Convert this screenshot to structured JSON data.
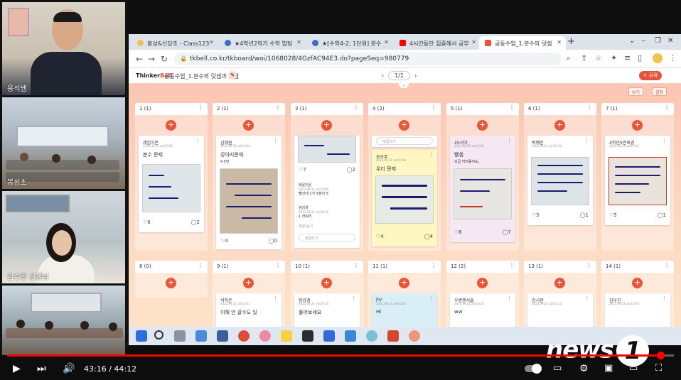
{
  "webcams": [
    {
      "label": "용석쌤"
    },
    {
      "label": "봉성초"
    },
    {
      "label": "김수연 선생님"
    },
    {
      "label": ""
    }
  ],
  "browser": {
    "tabs": [
      {
        "label": "봉성&신당초 - Class123"
      },
      {
        "label": "★4학년2학기 수학 밥팅"
      },
      {
        "label": "★[수학4-2, 1단원] 분수"
      },
      {
        "label": "4시간동안 집중해서 공부"
      },
      {
        "label": "공동수업_1.분수의 덧셈"
      }
    ],
    "url": "tkbell.co.kr/tkboard/woi/1068028/4GzfAC94E3.do?pageSeq=980779"
  },
  "app": {
    "logo_a": "Thinker",
    "logo_b": "Bell",
    "board_title": "공동수업_1.분수의 덧셈과 뺄셈",
    "pager": "1/1",
    "share_label": "+ 공유",
    "btn_a": "보기",
    "btn_b": "설정"
  },
  "columns_row1": [
    {
      "head": "1 (1)",
      "card": {
        "name": "레임이온",
        "date": "2023.09.21 am10:00",
        "title": "분수 문제",
        "likes": "6",
        "comments": "2"
      }
    },
    {
      "head": "2 (1)",
      "card": {
        "name": "김혜원",
        "date": "2023.09.21 am10:09",
        "title": "강아지문제",
        "sub": "4 5번",
        "likes": "4",
        "comments": "0"
      }
    },
    {
      "head": "3 (1)",
      "card": {
        "likes": "7",
        "comments": "2",
        "r1_name": "레몬이온",
        "r1_date": "2023.09.21 am10:09",
        "r1_text": "뺄건데",
        "r1_text2": "1가 5분의 5",
        "r2_name": "왕잉경",
        "r2_date": "2023.09.21 am10:21",
        "r2_text": "1 라워리",
        "more": "댓글 숨기",
        "input": "댓글쓰기"
      }
    },
    {
      "head": "4 (2)",
      "card": {
        "input": "댓글쓰기",
        "name": "초모주",
        "date": "2023.09.21 am10:08",
        "title": "우리 문제",
        "likes": "4",
        "comments": "4"
      }
    },
    {
      "head": "5 (1)",
      "card": {
        "name": "45서아",
        "date": "2023.09.21 am10:04",
        "title": "뺄셈",
        "sub": "초급 어려움자도..",
        "likes": "6",
        "comments": "7"
      }
    },
    {
      "head": "6 (1)",
      "card": {
        "name": "박예인",
        "date": "2023.09.21 am10:20",
        "likes": "5",
        "comments": "1"
      }
    },
    {
      "head": "7 (1)",
      "card": {
        "name": "4학년5반제경",
        "date": "2023.09.21 am10:11",
        "likes": "5",
        "comments": "1"
      }
    }
  ],
  "columns_row2": [
    {
      "head": "8 (0)"
    },
    {
      "head": "9 (1)",
      "card": {
        "name": "석하은",
        "date": "2023.09.21 am10:11",
        "title": "이해 안 갈수도 있"
      }
    },
    {
      "head": "10 (1)",
      "card": {
        "name": "왕강경",
        "date": "2023.09.21 am10:19",
        "title": "풀어보세요"
      }
    },
    {
      "head": "11 (1)",
      "card": {
        "name": "Jsy",
        "date": "2023.09.21 am10:07",
        "title": "Hi"
      }
    },
    {
      "head": "12 (2)",
      "card": {
        "name": "우병쟁서율",
        "date": "2023.09.21 am10:10",
        "title": "ww"
      }
    },
    {
      "head": "13 (1)",
      "card": {
        "name": "김시현",
        "date": "2023.09.21 am10:13"
      }
    },
    {
      "head": "14 (1)",
      "card": {
        "name": "김우진",
        "date": "2023.09.21 am10:02"
      }
    }
  ],
  "player": {
    "current": "43:16",
    "separator": "/",
    "total": "44:12",
    "progress_fraction": 0.98,
    "watermark": "news",
    "watermark_one": "1"
  },
  "colors": {
    "accent": "#e8553b",
    "progress": "#ff0000"
  }
}
